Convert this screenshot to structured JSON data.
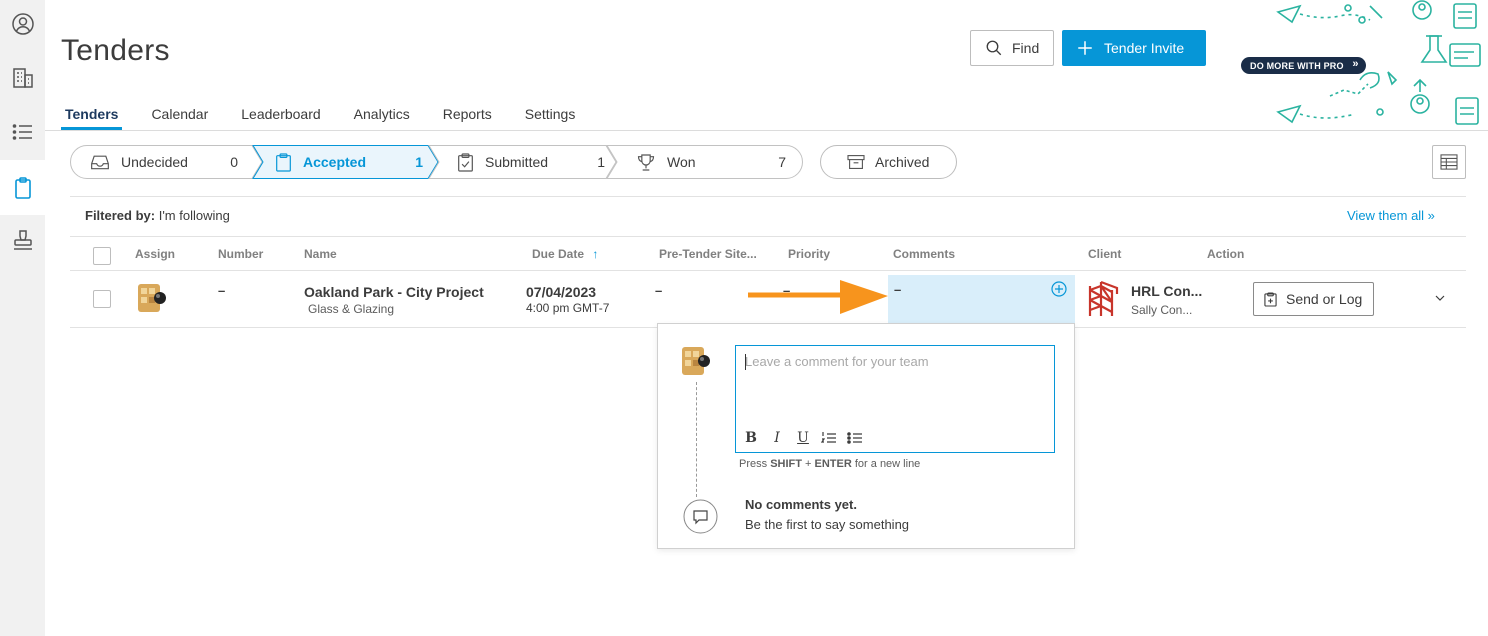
{
  "app": {
    "title": "Tenders",
    "find_label": "Find",
    "invite_label": "Tender Invite",
    "pro_badge": "DO MORE WITH PRO",
    "accent": "#0696d7"
  },
  "rail": [
    {
      "icon": "user-circle-icon"
    },
    {
      "icon": "building-icon"
    },
    {
      "icon": "list-icon"
    },
    {
      "icon": "clipboard-icon",
      "active": true
    },
    {
      "icon": "stamp-icon"
    }
  ],
  "tabs": [
    {
      "label": "Tenders",
      "active": true
    },
    {
      "label": "Calendar"
    },
    {
      "label": "Leaderboard"
    },
    {
      "label": "Analytics"
    },
    {
      "label": "Reports"
    },
    {
      "label": "Settings"
    }
  ],
  "stages": [
    {
      "label": "Undecided",
      "count": "0",
      "icon": "inbox-icon"
    },
    {
      "label": "Accepted",
      "count": "1",
      "icon": "clipboard-icon",
      "active": true
    },
    {
      "label": "Submitted",
      "count": "1",
      "icon": "clipboard-check-icon"
    },
    {
      "label": "Won",
      "count": "7",
      "icon": "trophy-icon"
    }
  ],
  "archived_label": "Archived",
  "filter": {
    "prefix": "Filtered by:",
    "value": "I'm following",
    "view_all": "View them all »"
  },
  "table": {
    "headers": {
      "assign": "Assign",
      "number": "Number",
      "name": "Name",
      "due": "Due Date",
      "pretender": "Pre-Tender Site...",
      "priority": "Priority",
      "comments": "Comments",
      "client": "Client",
      "action": "Action"
    },
    "sort_indicator": "↑",
    "row": {
      "number": "–",
      "name": "Oakland Park - City Project",
      "trade": "Glass & Glazing",
      "due_date": "07/04/2023",
      "due_time": "4:00 pm GMT-7",
      "pretender": "–",
      "priority": "–",
      "comments": "–",
      "client_name": "HRL Con...",
      "client_contact": "Sally Con...",
      "action_label": "Send or Log"
    }
  },
  "comment_popover": {
    "placeholder": "Leave a comment for your team",
    "toolbar": [
      "B",
      "I",
      "U"
    ],
    "hint_pre": "Press",
    "hint_shift": "SHIFT",
    "hint_plus": "+",
    "hint_enter": "ENTER",
    "hint_post": "for a new line",
    "empty_title": "No comments yet.",
    "empty_sub": "Be the first to say something"
  }
}
